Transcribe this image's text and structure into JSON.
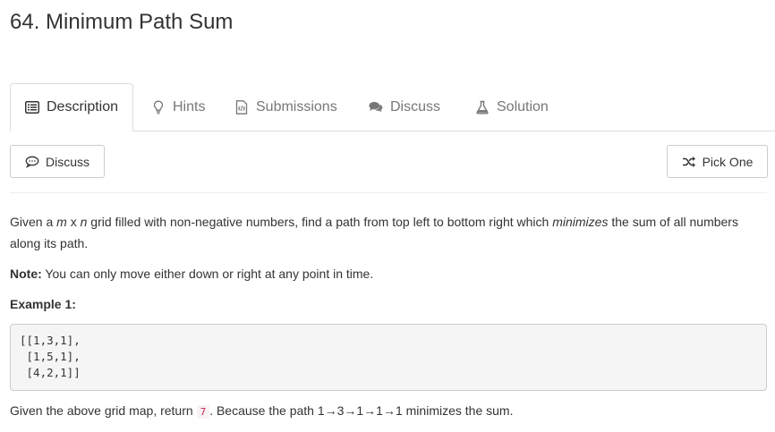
{
  "problem": {
    "title": "64. Minimum Path Sum"
  },
  "tabs": [
    {
      "label": "Description",
      "icon": "list-icon",
      "active": true
    },
    {
      "label": "Hints",
      "icon": "lightbulb-icon",
      "active": false
    },
    {
      "label": "Submissions",
      "icon": "code-file-icon",
      "active": false
    },
    {
      "label": "Discuss",
      "icon": "comments-icon",
      "active": false
    },
    {
      "label": "Solution",
      "icon": "flask-icon",
      "active": false
    }
  ],
  "actions": {
    "discuss_label": "Discuss",
    "pick_one_label": "Pick One"
  },
  "content": {
    "intro_1": "Given a ",
    "intro_m": "m",
    "intro_x": " x ",
    "intro_n": "n",
    "intro_2": " grid filled with non-negative numbers, find a path from top left to bottom right which ",
    "intro_em": "minimizes",
    "intro_3": " the sum of all numbers along its path.",
    "note_label": "Note:",
    "note_text": " You can only move either down or right at any point in time.",
    "example_label": "Example 1:",
    "example_code": "[[1,3,1],\n [1,5,1],\n [4,2,1]]",
    "result_1": "Given the above grid map, return ",
    "result_code": "7",
    "result_2": ". Because the path 1→3→1→1→1 minimizes the sum."
  },
  "colors": {
    "inline_code_text": "#c7254e",
    "inline_code_bg": "#f9f2f4",
    "border": "#dddddd"
  }
}
